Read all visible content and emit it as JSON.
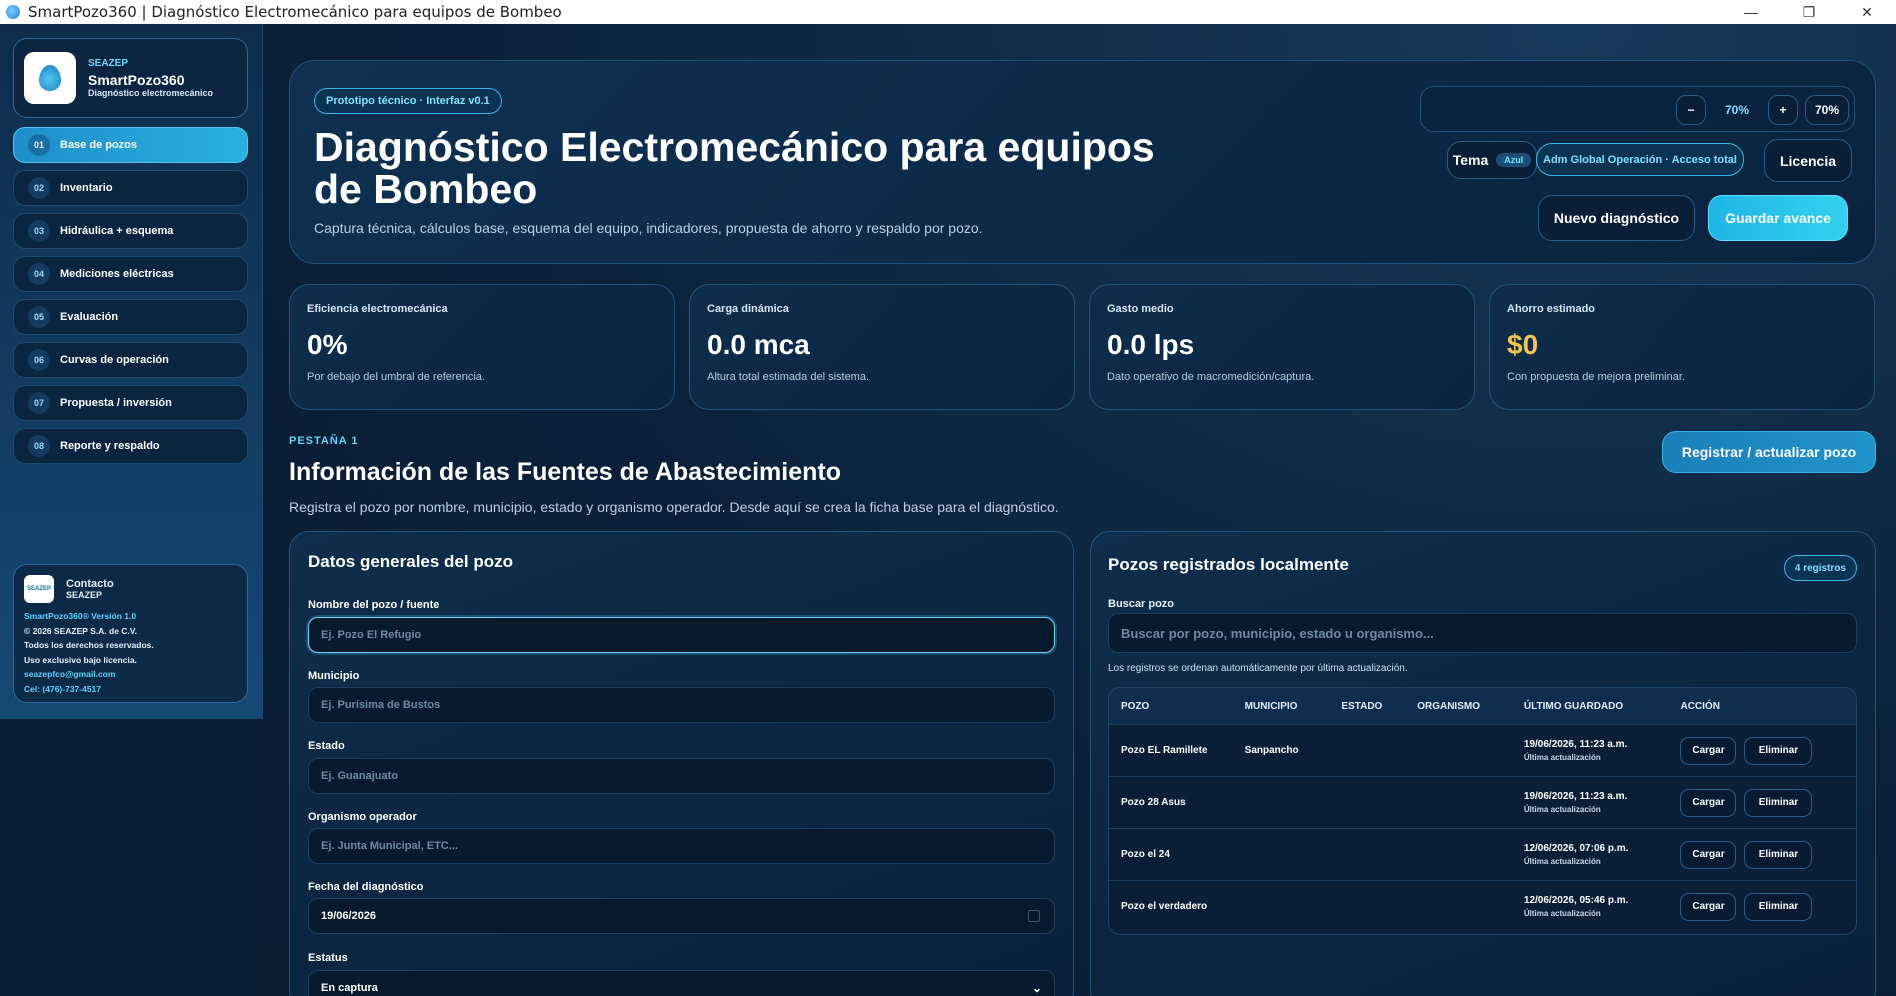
{
  "window": {
    "title": "SmartPozo360 | Diagnóstico Electromecánico para equipos de Bombeo",
    "minimize": "—",
    "restore": "❐",
    "close": "✕"
  },
  "brand": {
    "org": "SEAZEP",
    "name": "SmartPozo360",
    "subtitle": "Diagnóstico electromecánico"
  },
  "nav": [
    {
      "num": "01",
      "label": "Base de pozos",
      "active": true
    },
    {
      "num": "02",
      "label": "Inventario"
    },
    {
      "num": "03",
      "label": "Hidráulica + esquema"
    },
    {
      "num": "04",
      "label": "Mediciones eléctricas"
    },
    {
      "num": "05",
      "label": "Evaluación"
    },
    {
      "num": "06",
      "label": "Curvas de operación"
    },
    {
      "num": "07",
      "label": "Propuesta / inversión"
    },
    {
      "num": "08",
      "label": "Reporte y respaldo"
    }
  ],
  "contact": {
    "logo_text": "SEAZEP",
    "title": "Contacto",
    "org": "SEAZEP",
    "version": "SmartPozo360® Versión 1.0",
    "copyright": "© 2026 SEAZEP S.A. de C.V.",
    "rights": "Todos los derechos reservados.",
    "license": "Uso exclusivo bajo licencia.",
    "email": "seazepfco@gmail.com",
    "phone": "Cel: (476)-737-4517"
  },
  "hero": {
    "badge": "Prototipo técnico · Interfaz v0.1",
    "title": "Diagnóstico Electromecánico para equipos de Bombeo",
    "subtitle": "Captura técnica, cálculos base, esquema del equipo, indicadores, propuesta de ahorro y respaldo por pozo.",
    "zoom_minus": "−",
    "zoom_value": "70%",
    "zoom_plus": "+",
    "zoom_reset": "70%",
    "theme_label": "Tema",
    "theme_value": "Azul",
    "role": "Adm Global Operación · Acceso total",
    "license": "Licencia",
    "new_diag": "Nuevo diagnóstico",
    "save": "Guardar avance"
  },
  "kpis": [
    {
      "label": "Eficiencia electromecánica",
      "value": "0%",
      "foot": "Por debajo del umbral de referencia."
    },
    {
      "label": "Carga dinámica",
      "value": "0.0 mca",
      "foot": "Altura total estimada del sistema."
    },
    {
      "label": "Gasto medio",
      "value": "0.0 lps",
      "foot": "Dato operativo de macromedición/captura."
    },
    {
      "label": "Ahorro estimado",
      "value": "$0",
      "foot": "Con propuesta de mejora preliminar."
    }
  ],
  "section": {
    "kicker": "PESTAÑA 1",
    "title": "Información de las Fuentes de Abastecimiento",
    "subtitle": "Registra el pozo por nombre, municipio, estado y organismo operador. Desde aquí se crea la ficha base para el diagnóstico.",
    "register_button": "Registrar / actualizar pozo"
  },
  "form": {
    "title": "Datos generales del pozo",
    "name_label": "Nombre del pozo / fuente",
    "name_placeholder": "Ej. Pozo El Refugio",
    "municipio_label": "Municipio",
    "municipio_placeholder": "Ej. Purísima de Bustos",
    "estado_label": "Estado",
    "estado_placeholder": "Ej. Guanajuato",
    "organismo_label": "Organismo operador",
    "organismo_placeholder": "Ej. Junta Municipal, ETC...",
    "fecha_label": "Fecha del diagnóstico",
    "fecha_value": "19/06/2026",
    "estatus_label": "Estatus",
    "estatus_value": "En captura"
  },
  "list": {
    "title": "Pozos registrados localmente",
    "count": "4 registros",
    "search_label": "Buscar pozo",
    "search_placeholder": "Buscar por pozo, municipio, estado u organismo...",
    "hint": "Los registros se ordenan automáticamente por última actualización.",
    "columns": [
      "POZO",
      "MUNICIPIO",
      "ESTADO",
      "ORGANISMO",
      "ÚLTIMO GUARDADO",
      "ACCIÓN"
    ],
    "load_label": "Cargar",
    "delete_label": "Eliminar",
    "rows": [
      {
        "pozo": "Pozo EL Ramillete",
        "municipio": "Sanpancho",
        "estado": "",
        "organismo": "",
        "fecha": "19/06/2026, 11:23 a.m.",
        "nota": "Última actualización"
      },
      {
        "pozo": "Pozo 28 Asus",
        "municipio": "",
        "estado": "",
        "organismo": "",
        "fecha": "19/06/2026, 11:23 a.m.",
        "nota": "Última actualización"
      },
      {
        "pozo": "Pozo el 24",
        "municipio": "",
        "estado": "",
        "organismo": "",
        "fecha": "12/06/2026, 07:06 p.m.",
        "nota": "Última actualización"
      },
      {
        "pozo": "Pozo el verdadero",
        "municipio": "",
        "estado": "",
        "organismo": "",
        "fecha": "12/06/2026, 05:46 p.m.",
        "nota": "Última actualización"
      }
    ]
  },
  "colors": {
    "accent": "#2ab0e0",
    "gold": "#f4c451",
    "bg": "#0a1e33"
  }
}
